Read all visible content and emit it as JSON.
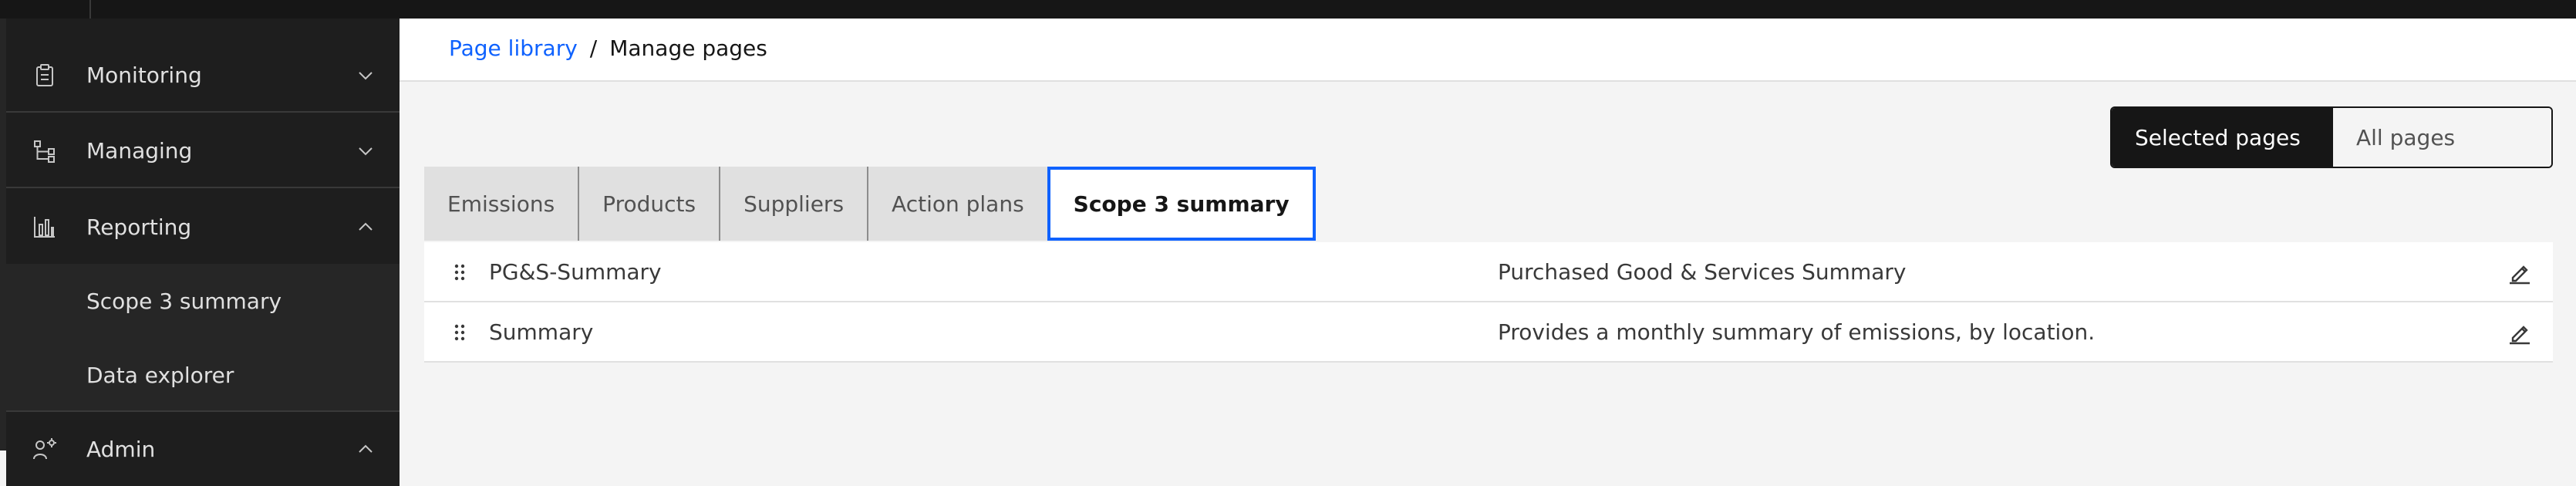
{
  "sidebar": {
    "groups": [
      {
        "label": "Monitoring",
        "icon": "clipboard-icon",
        "expanded": false
      },
      {
        "label": "Managing",
        "icon": "hierarchy-icon",
        "expanded": false
      },
      {
        "label": "Reporting",
        "icon": "bar-chart-icon",
        "expanded": true,
        "items": [
          {
            "label": "Scope 3 summary"
          },
          {
            "label": "Data explorer"
          }
        ]
      },
      {
        "label": "Admin",
        "icon": "user-admin-icon",
        "expanded": true
      }
    ]
  },
  "breadcrumb": {
    "parent": "Page library",
    "separator": "/",
    "current": "Manage pages"
  },
  "toggle": {
    "selected": "Selected pages",
    "other": "All pages"
  },
  "tabs": [
    {
      "label": "Emissions"
    },
    {
      "label": "Products"
    },
    {
      "label": "Suppliers"
    },
    {
      "label": "Action plans"
    },
    {
      "label": "Scope 3 summary",
      "active": true
    }
  ],
  "rows": [
    {
      "name": "PG&S-Summary",
      "description": "Purchased Good & Services Summary"
    },
    {
      "name": "Summary",
      "description": "Provides a monthly summary of emissions, by location."
    }
  ],
  "colors": {
    "accent": "#0f62fe",
    "sidebar_bg": "#1e1e1e",
    "page_bg": "#f4f4f4"
  }
}
